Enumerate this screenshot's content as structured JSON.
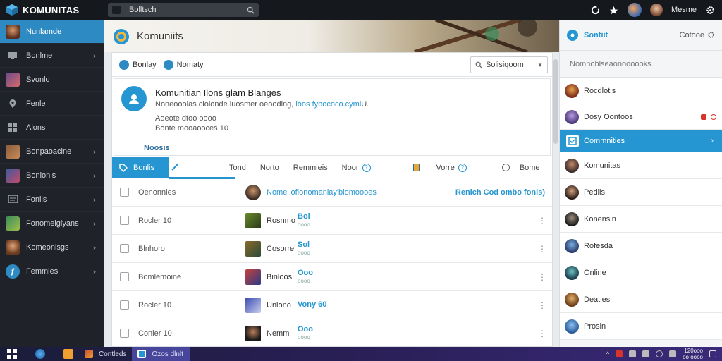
{
  "app": {
    "brand": "KOMUNITAS",
    "search_text": "Bolltsch",
    "user_name": "Mesme"
  },
  "sidebar": {
    "items": [
      {
        "label": "Nunlamde",
        "icon": "avatar-icon",
        "active": true
      },
      {
        "label": "Bonlme",
        "icon": "monitor-icon",
        "chevron": true
      },
      {
        "label": "Svonlo",
        "icon": "gamepad-icon"
      },
      {
        "label": "Fenle",
        "icon": "location-pin-icon"
      },
      {
        "label": "Alons",
        "icon": "grid-icon"
      },
      {
        "label": "Bonpaoacine",
        "icon": "game-thumb-icon",
        "chevron": true
      },
      {
        "label": "Bonlonls",
        "icon": "game-thumb-icon",
        "chevron": true
      },
      {
        "label": "Fonlis",
        "icon": "grid-icon",
        "chevron": true
      },
      {
        "label": "Fonomelglyans",
        "icon": "game-thumb-icon",
        "chevron": true
      },
      {
        "label": "Komeonlsgs",
        "icon": "avatar-icon",
        "chevron": true
      },
      {
        "label": "Femmles",
        "icon": "circle-s-icon",
        "chevron": true
      }
    ]
  },
  "main": {
    "banner_title": "Komuniits",
    "filters": [
      {
        "label": "Bonlay"
      },
      {
        "label": "Nomaty"
      }
    ],
    "sort_label": "Solisiqoom",
    "info": {
      "title": "Komunitian Ilons glam Blanges",
      "line1_prefix": "Noneooolas ciolonde luosmer oeooding, ",
      "line1_link": "ioos fybococo.cyml",
      "line1_suffix": "U.",
      "line2": "Aoeote dtoo oooo",
      "line3": "Bonte mooaooces 10",
      "link": "Noosis"
    },
    "tabs": [
      {
        "label": "Bonlis",
        "active": true
      },
      {
        "label": "Tond"
      },
      {
        "label": "Norto"
      },
      {
        "label": "Remmieis"
      },
      {
        "label": "Noor",
        "hint": "?"
      },
      {
        "label": "Vorre",
        "hint": "?"
      },
      {
        "label": "Bome"
      }
    ],
    "header_row": {
      "name": "Oenonnies",
      "game": "Nome 'ofionomanlay'blomoooes",
      "right": "Renich Cod ombo fonis)"
    },
    "rows": [
      {
        "name": "Rocler 10",
        "game": "Rosnmo",
        "val": "Bol",
        "sub": "oooo"
      },
      {
        "name": "Blnhoro",
        "game": "Cosorre",
        "val": "Sol",
        "sub": "oooo"
      },
      {
        "name": "Bomlemoine",
        "game": "Binloos",
        "val": "Ooo",
        "sub": "oooo"
      },
      {
        "name": "Rocler 10",
        "game": "Unlono",
        "val": "Vony 60",
        "sub": ""
      },
      {
        "name": "Conler 10",
        "game": "Nemm",
        "val": "Ooo",
        "sub": "oooo"
      }
    ]
  },
  "rpanel": {
    "title": "Sontiit",
    "right": "Cotooe",
    "subheader": "Nomnoblseaonoooooks",
    "items": [
      {
        "label": "Rocdlotis"
      },
      {
        "label": "Dosy Oontoos",
        "badges": true
      },
      {
        "label": "Commnities",
        "active": true
      },
      {
        "label": "Komunitas"
      },
      {
        "label": "Pedlis"
      },
      {
        "label": "Konensin"
      },
      {
        "label": "Rofesda"
      },
      {
        "label": "Online"
      },
      {
        "label": "Deatles"
      },
      {
        "label": "Prosin"
      }
    ]
  },
  "taskbar": {
    "task1": "Contleds",
    "task2": "Ozos dlnlt",
    "clock_line1": "120ooo",
    "clock_line2": "oo oooo"
  },
  "colors": {
    "accent": "#2596d1",
    "sidebar_bg": "#1f2329",
    "topbar_bg": "#15181d"
  }
}
